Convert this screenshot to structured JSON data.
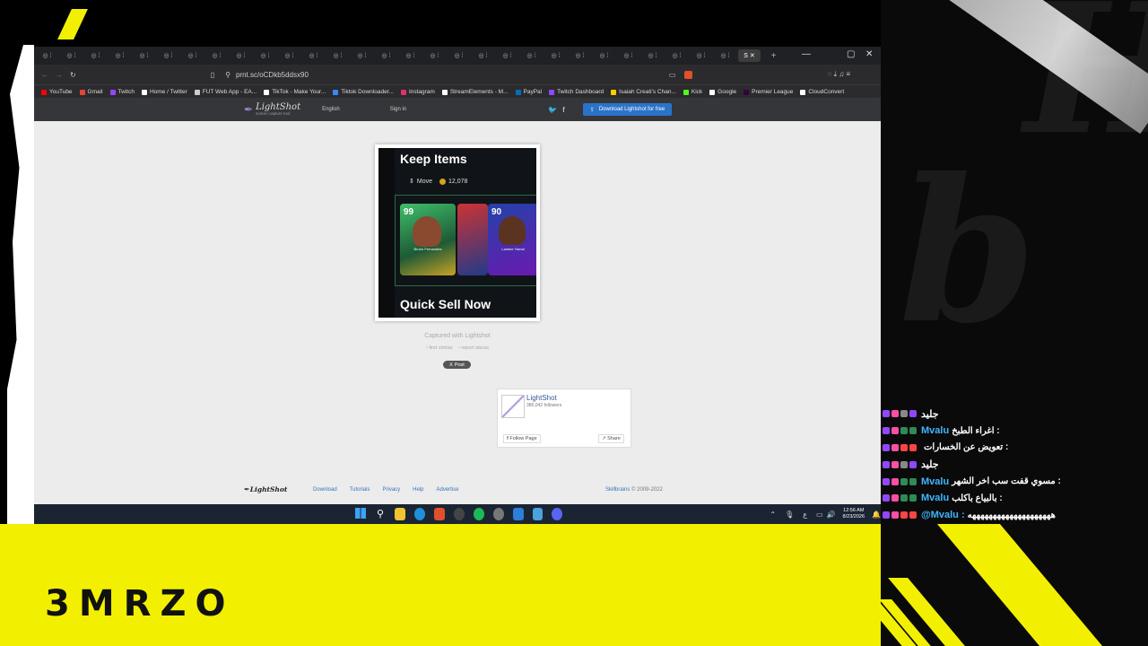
{
  "overlay": {
    "streamer_name": "3MRZO"
  },
  "chat": [
    {
      "name": "جليد",
      "name_color": "#ffffff",
      "message": "",
      "name_first": true,
      "badges": [
        "#9147ff",
        "#ff4fa3",
        "#888888",
        "#9147ff"
      ]
    },
    {
      "name": "Mvalu",
      "name_color": "#3fb7ff",
      "message": "اغراء الطبخ :",
      "badges": [
        "#9147ff",
        "#ff4fa3",
        "#2e8b57",
        "#2e8b57"
      ]
    },
    {
      "name": "",
      "name_color": "#ffffff",
      "message": "تعويض عن الخسارات :",
      "badges": [
        "#9147ff",
        "#ff4fa3",
        "#ff4444",
        "#ff4444"
      ]
    },
    {
      "name": "جليد",
      "name_color": "#ffffff",
      "message": "",
      "badges": [
        "#9147ff",
        "#ff4fa3",
        "#888888",
        "#9147ff"
      ]
    },
    {
      "name": "Mvalu",
      "name_color": "#3fb7ff",
      "message": "مسوي قفت سب اخر الشهر :",
      "badges": [
        "#9147ff",
        "#ff4fa3",
        "#2e8b57",
        "#2e8b57"
      ]
    },
    {
      "name": "Mvalu",
      "name_color": "#3fb7ff",
      "message": "بالبياع باكلب :",
      "badges": [
        "#9147ff",
        "#ff4fa3",
        "#2e8b57",
        "#2e8b57"
      ]
    },
    {
      "name": "@Mvalu :",
      "name_color": "#3fb7ff",
      "message": "ههههههههههههههههههههه",
      "badges": [
        "#9147ff",
        "#ff4fa3",
        "#ff4444",
        "#ff4444"
      ]
    }
  ],
  "browser": {
    "url": "prnt.sc/oCDkb5ddsx90",
    "active_tab": "S",
    "bookmarks": [
      {
        "label": "YouTube",
        "color": "#ff0000"
      },
      {
        "label": "Gmail",
        "color": "#ea4335"
      },
      {
        "label": "Twitch",
        "color": "#9147ff"
      },
      {
        "label": "Home / Twitter",
        "color": "#ffffff"
      },
      {
        "label": "FUT Web App - EA...",
        "color": "#cccccc"
      },
      {
        "label": "TikTok - Make Your...",
        "color": "#ffffff"
      },
      {
        "label": "Tiktok Downloader...",
        "color": "#3a86ff"
      },
      {
        "label": "Instagram",
        "color": "#e1306c"
      },
      {
        "label": "StreamElements - M...",
        "color": "#ffffff"
      },
      {
        "label": "PayPal",
        "color": "#0070ba"
      },
      {
        "label": "Twitch Dashboard",
        "color": "#9147ff"
      },
      {
        "label": "Isaiah Creati's Chan...",
        "color": "#ffcc00"
      },
      {
        "label": "Kick",
        "color": "#53fc18"
      },
      {
        "label": "Google",
        "color": "#ffffff"
      },
      {
        "label": "Premier League",
        "color": "#37003c"
      },
      {
        "label": "CloudConvert",
        "color": "#ffffff"
      }
    ]
  },
  "lightshot": {
    "logo": "LightShot",
    "tagline": "screen capture tool",
    "language": "English",
    "sign_in": "Sign in",
    "download_button": "Download Lightshot for free",
    "captured_with": "Captured with Lightshot",
    "find_similar": "find similar",
    "report_abuse": "report abuse",
    "post_button": "Post",
    "fb_page_name": "LightShot",
    "fb_followers": "386,042 followers",
    "fb_follow": "Follow Page",
    "fb_share": "Share",
    "footer_logo": "LightShot",
    "footer_links": [
      "Download",
      "Tutorials",
      "Privacy",
      "Help",
      "Advertise"
    ],
    "copyright_brand": "Skillbrains",
    "copyright_years": "© 2009-2022"
  },
  "screenshot_content": {
    "title": "Keep Items",
    "move_label": "Move",
    "coins": "12,078",
    "card1_rating": "99",
    "card1_name": "Bruno Fernandes",
    "card3_rating": "90",
    "card3_name": "Lamine Yamal",
    "bottom_label": "Quick Sell Now"
  },
  "taskbar": {
    "time": "12:56 AM",
    "date": "8/23/2026"
  },
  "colors": {
    "accent_yellow": "#f2f000",
    "ls_button": "#2a73c9"
  }
}
